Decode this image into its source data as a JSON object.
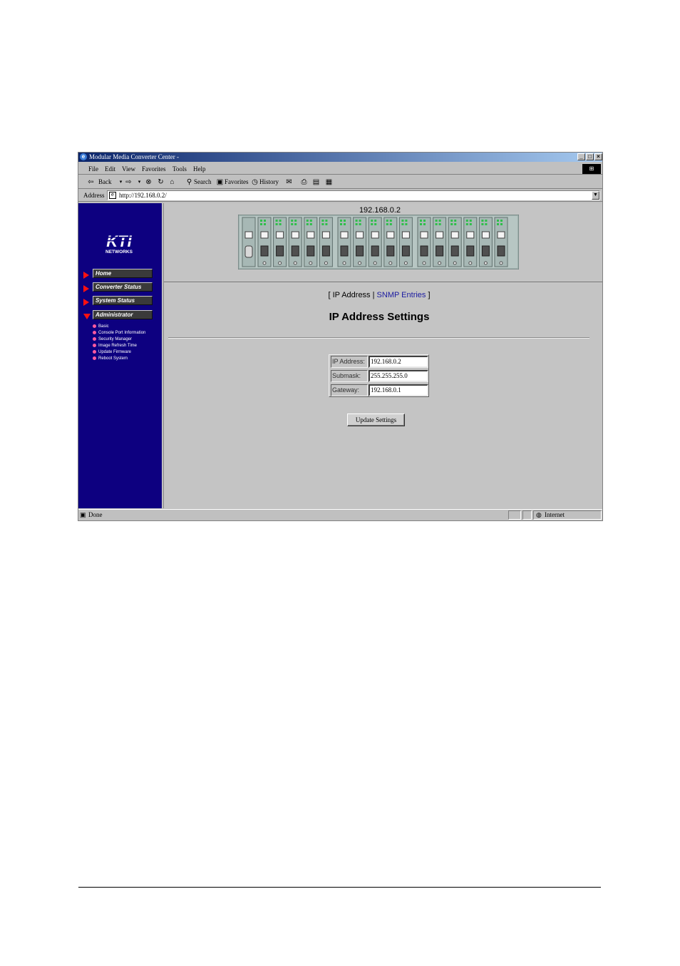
{
  "window": {
    "title": "Modular Media Converter Center -",
    "controls": {
      "minimize": "_",
      "maximize": "□",
      "close": "×"
    }
  },
  "menu": [
    "File",
    "Edit",
    "View",
    "Favorites",
    "Tools",
    "Help"
  ],
  "toolbar": {
    "back": "Back",
    "search": "Search",
    "favorites": "Favorites",
    "history": "History"
  },
  "address": {
    "label": "Address",
    "url": "http://192.168.0.2/"
  },
  "sidebar": {
    "logo_main": "KTI",
    "logo_sub": "NETWORKS",
    "nav": [
      {
        "label": "Home",
        "expanded": false
      },
      {
        "label": "Converter Status",
        "expanded": false
      },
      {
        "label": "System Status",
        "expanded": false
      },
      {
        "label": "Administrator",
        "expanded": true
      }
    ],
    "submenu": [
      "Basic",
      "Console Port Information",
      "Security Manager",
      "Image Refresh Time",
      "Update Firmware",
      "Reboot System"
    ]
  },
  "device": {
    "ip": "192.168.0.2"
  },
  "main": {
    "tab_open": "[",
    "tab_ip": "IP Address",
    "tab_sep": "|",
    "tab_snmp": "SNMP Entries",
    "tab_close": "]",
    "title": "IP Address Settings",
    "fields": [
      {
        "label": "IP Address:",
        "value": "192.168.0.2"
      },
      {
        "label": "Submask:",
        "value": "255.255.255.0"
      },
      {
        "label": "Gateway:",
        "value": "192.168.0.1"
      }
    ],
    "button": "Update Settings"
  },
  "statusbar": {
    "status": "Done",
    "zone": "Internet"
  },
  "colors": {
    "sidebar": "#0d0080",
    "nav_arrow": "#ff1010",
    "link": "#1a1aa0",
    "bullet": "#ff5aa0"
  }
}
